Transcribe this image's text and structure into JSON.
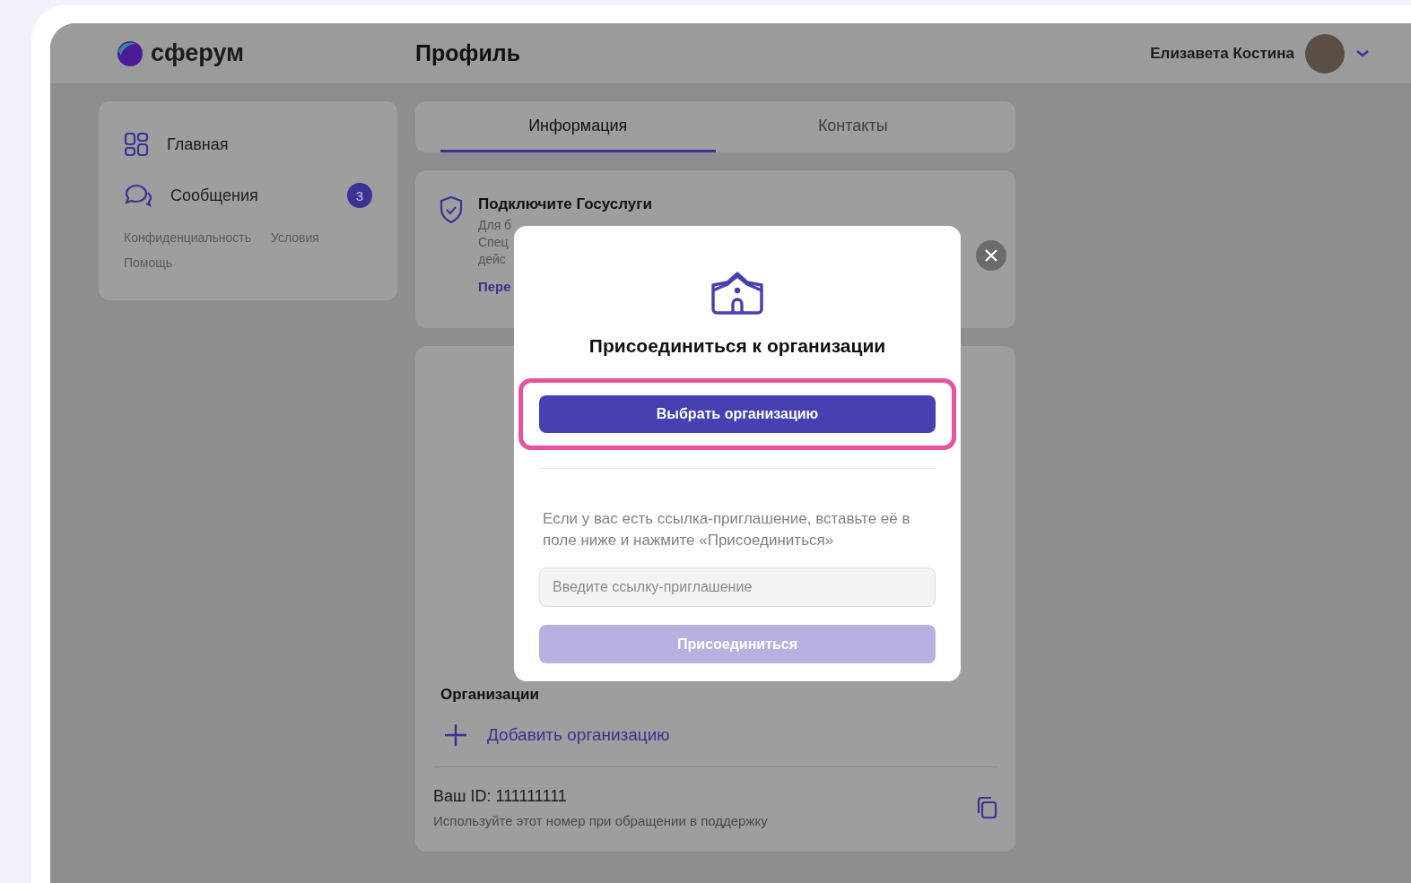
{
  "header": {
    "logo": "сферум",
    "title": "Профиль",
    "user_name": "Елизавета Костина"
  },
  "sidebar": {
    "items": [
      {
        "label": "Главная",
        "kind": "home"
      },
      {
        "label": "Сообщения",
        "kind": "messages",
        "badge": "3"
      }
    ],
    "links": [
      "Конфиденциальность",
      "Условия",
      "Помощь"
    ]
  },
  "tabs": [
    {
      "label": "Информация",
      "selected": true
    },
    {
      "label": "Контакты",
      "selected": false
    }
  ],
  "gosuslugi": {
    "title": "Подключите Госуслуги",
    "lines": [
      "Для б",
      "Спец",
      "дейс"
    ],
    "link": "Пере"
  },
  "modal": {
    "title": "Присоединиться к организации",
    "primary_button": "Выбрать организацию",
    "highlighted": true,
    "hint": "Если у вас есть ссылка-приглашение, вставьте её в поле ниже и нажмите «Присоединиться»",
    "input": {
      "placeholder": "Введите ссылку-приглашение"
    },
    "join_button": {
      "label": "Присоединиться",
      "disabled": true
    }
  },
  "organizations": {
    "heading": "Организации",
    "add_label": "Добавить организацию"
  },
  "id_block": {
    "id_text": "Ваш ID: 111111111",
    "hint": "Используйте этот номер при обращении в поддержку"
  }
}
